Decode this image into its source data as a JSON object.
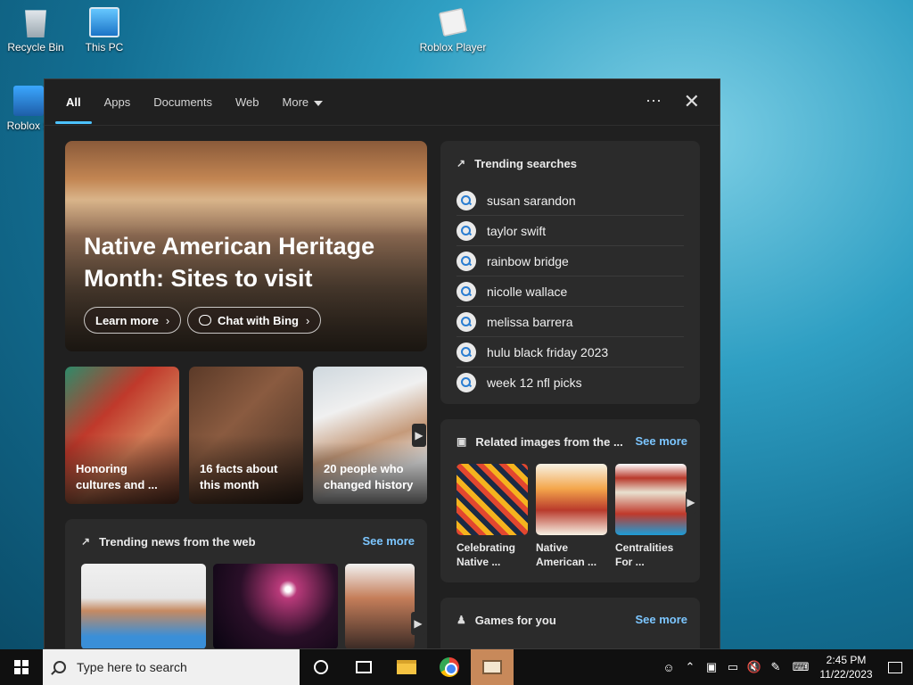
{
  "desktop": {
    "icons": [
      {
        "label": "Recycle Bin"
      },
      {
        "label": "This PC"
      },
      {
        "label": "Roblox Player"
      },
      {
        "label": "Roblox S"
      }
    ]
  },
  "search_panel": {
    "tabs": [
      {
        "label": "All"
      },
      {
        "label": "Apps"
      },
      {
        "label": "Documents"
      },
      {
        "label": "Web"
      },
      {
        "label": "More"
      }
    ],
    "more_label": "⋯",
    "close_label": "✕",
    "hero": {
      "title": "Native American Heritage Month: Sites to visit",
      "learn_more": "Learn more",
      "chat_with_bing": "Chat with Bing"
    },
    "cards": [
      {
        "caption": "Honoring cultures and ..."
      },
      {
        "caption": "16 facts about this month"
      },
      {
        "caption": "20 people who changed history"
      }
    ],
    "trending_news": {
      "title": "Trending news from the web",
      "see_more": "See more"
    },
    "trending_searches": {
      "title": "Trending searches",
      "items": [
        "susan sarandon",
        "taylor swift",
        "rainbow bridge",
        "nicolle wallace",
        "melissa barrera",
        "hulu black friday 2023",
        "week 12 nfl picks"
      ]
    },
    "related_images": {
      "title": "Related images from the ...",
      "see_more": "See more",
      "items": [
        {
          "caption": "Celebrating Native ..."
        },
        {
          "caption": "Native American ..."
        },
        {
          "caption": "Centralities For ..."
        }
      ]
    },
    "games": {
      "title": "Games for you",
      "see_more": "See more"
    }
  },
  "taskbar": {
    "search_placeholder": "Type here to search",
    "time": "2:45 PM",
    "date": "11/22/2023"
  }
}
